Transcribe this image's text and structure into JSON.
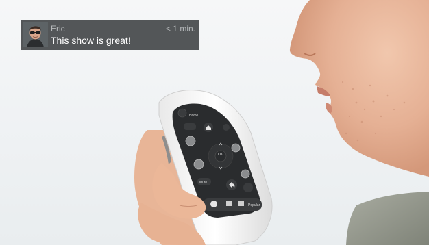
{
  "notification": {
    "sender": "Eric",
    "time": "< 1 min.",
    "message": "This show is great!",
    "avatar_icon": "person-with-sunglasses"
  },
  "remote": {
    "buttons": {
      "home": "Home",
      "mute": "Mute",
      "ok": "OK",
      "popular": "Popular"
    }
  },
  "colors": {
    "background": "#f3f5f6",
    "notification_bg": "#3c4042",
    "remote_shell": "#f2f2f2",
    "remote_face": "#2a2c2e"
  }
}
